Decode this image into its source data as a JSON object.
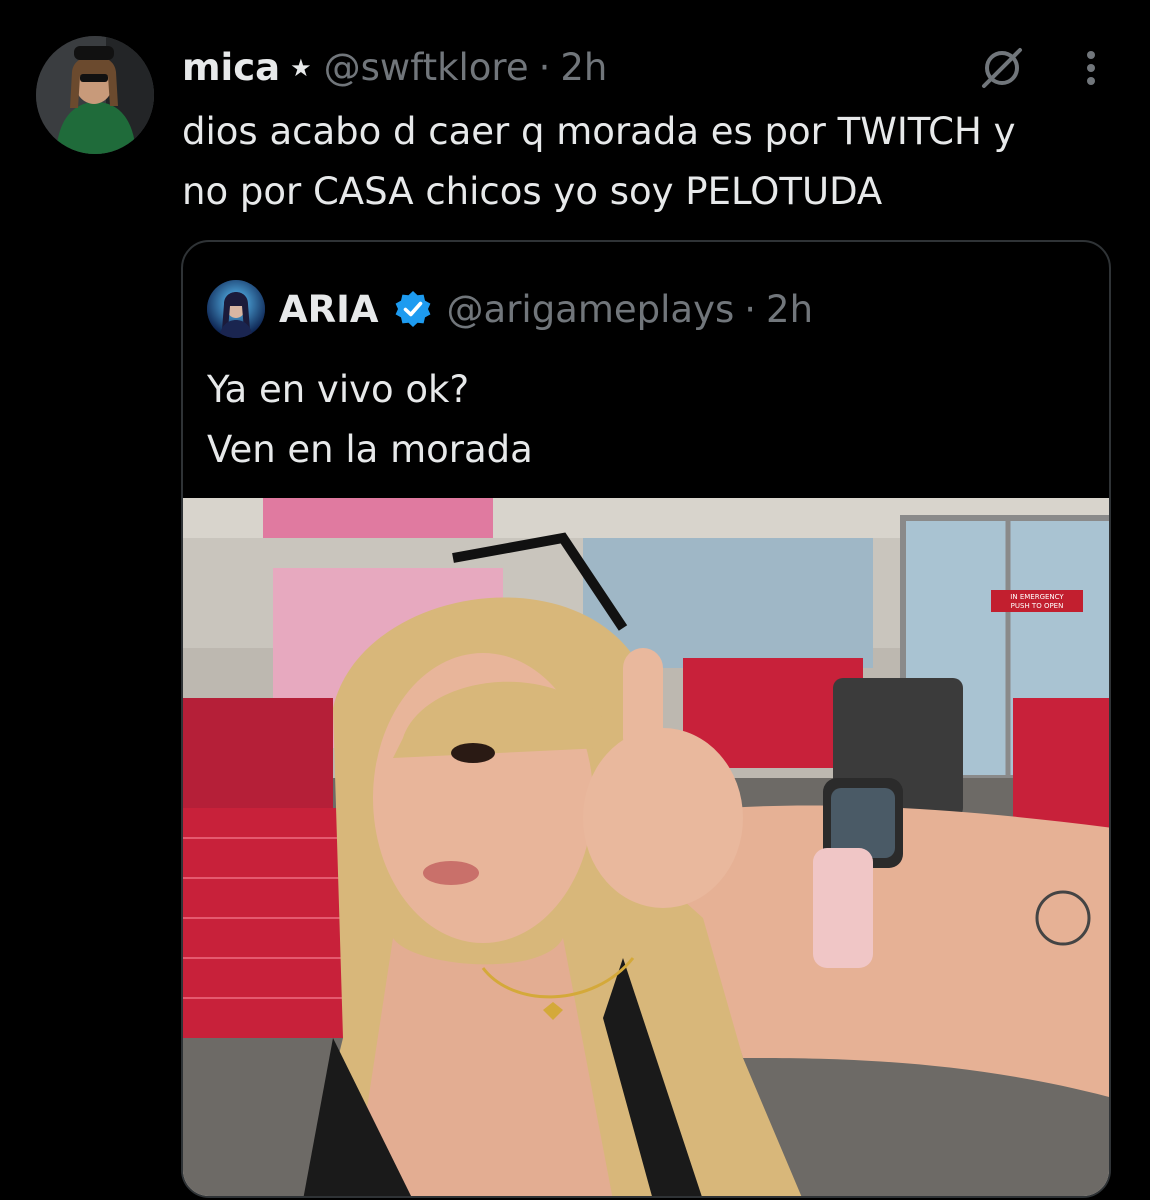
{
  "tweet": {
    "author_name": "mica",
    "author_badge": "★",
    "author_handle": "@swftklore",
    "separator": "·",
    "time": "2h",
    "text": "dios acabo d caer q morada es por TWITCH y\nno por CASA chicos yo soy PELOTUDA",
    "icons": {
      "grok": "grok-icon",
      "more": "more-dots-icon"
    }
  },
  "quoted": {
    "author_name": "ARIA",
    "author_handle": "@arigameplays",
    "separator": "·",
    "time": "2h",
    "verified_icon": "verified-badge-icon",
    "text": "Ya en vivo ok?\nVen en la morada",
    "photo": {
      "sign_text_line1": "IN EMERGENCY",
      "sign_text_line2": "PUSH TO OPEN"
    }
  },
  "colors": {
    "background": "#000000",
    "text_primary": "#e7e9ea",
    "text_secondary": "#71767b",
    "border": "#2f3336",
    "verified_blue": "#1d9bf0",
    "cart_red": "#c8213a"
  }
}
